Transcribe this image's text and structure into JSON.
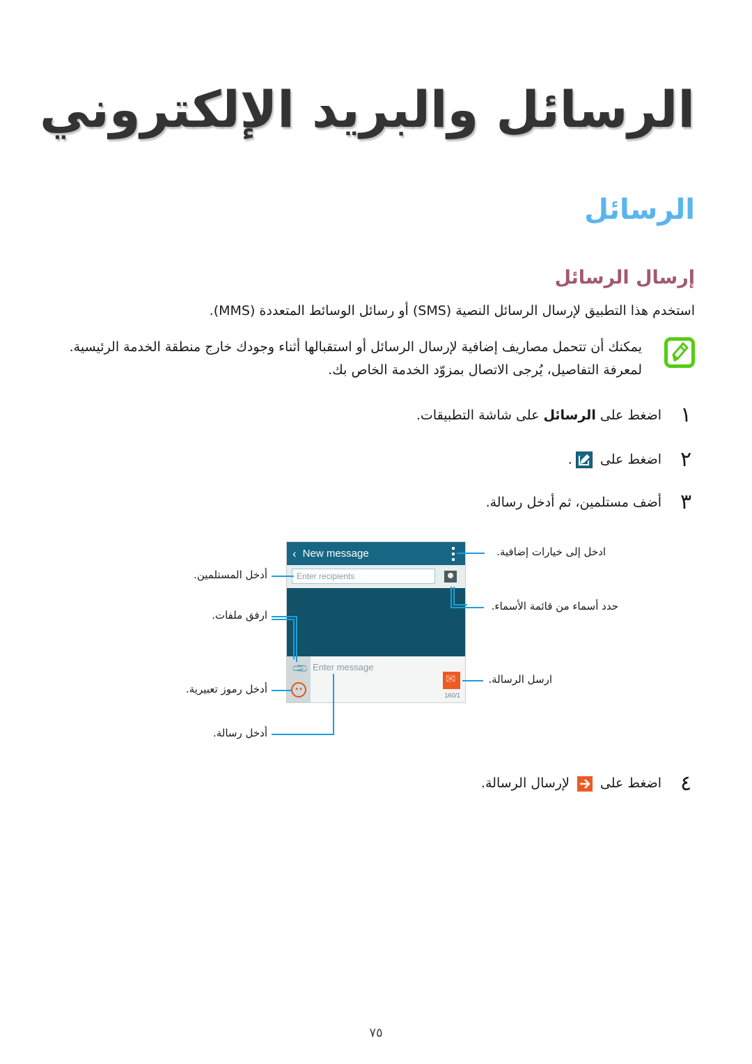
{
  "chapter_title": "الرسائل والبريد الإلكتروني",
  "section_title": "الرسائل",
  "subsection_title": "إرسال الرسائل",
  "intro": "استخدم هذا التطبيق لإرسال الرسائل النصية (SMS) أو رسائل الوسائط المتعددة (MMS).",
  "note": {
    "icon": "note-pencil-icon",
    "text": "يمكنك أن تتحمل مصاريف إضافية لإرسال الرسائل أو استقبالها أثناء وجودك خارج منطقة الخدمة الرئيسية. لمعرفة التفاصيل، يُرجى الاتصال بمزوّد الخدمة الخاص بك."
  },
  "steps": [
    {
      "num": "١",
      "before": "اضغط على ",
      "bold": "الرسائل",
      "after": " على شاشة التطبيقات."
    },
    {
      "num": "٢",
      "before": "اضغط على ",
      "icon": "compose-icon",
      "after": "."
    },
    {
      "num": "٣",
      "before": "أضف مستلمين، ثم أدخل رسالة."
    },
    {
      "num": "٤",
      "before": "اضغط على ",
      "icon": "send-arrow-icon",
      "after": " لإرسال الرسالة."
    }
  ],
  "phone": {
    "title": "New message",
    "recipients_placeholder": "Enter recipients",
    "message_placeholder": "Enter message",
    "char_count": "160/1"
  },
  "callouts": {
    "more_options": "ادخل إلى خيارات إضافية.",
    "contacts": "حدد أسماء من قائمة الأسماء.",
    "send": "ارسل الرسالة.",
    "recipients": "أدخل المستلمين.",
    "attach": "ارفق ملفات.",
    "emoticons": "أدخل رموز تعبيرية.",
    "message": "أدخل رسالة."
  },
  "colors": {
    "section_title": "#5ab4f0",
    "subsection_title": "#a05a6e",
    "note_icon": "#55cc11",
    "app_bar": "#176683",
    "send_button": "#ee5a24",
    "callout_line": "#1a9fdc"
  },
  "page_number": "٧٥"
}
